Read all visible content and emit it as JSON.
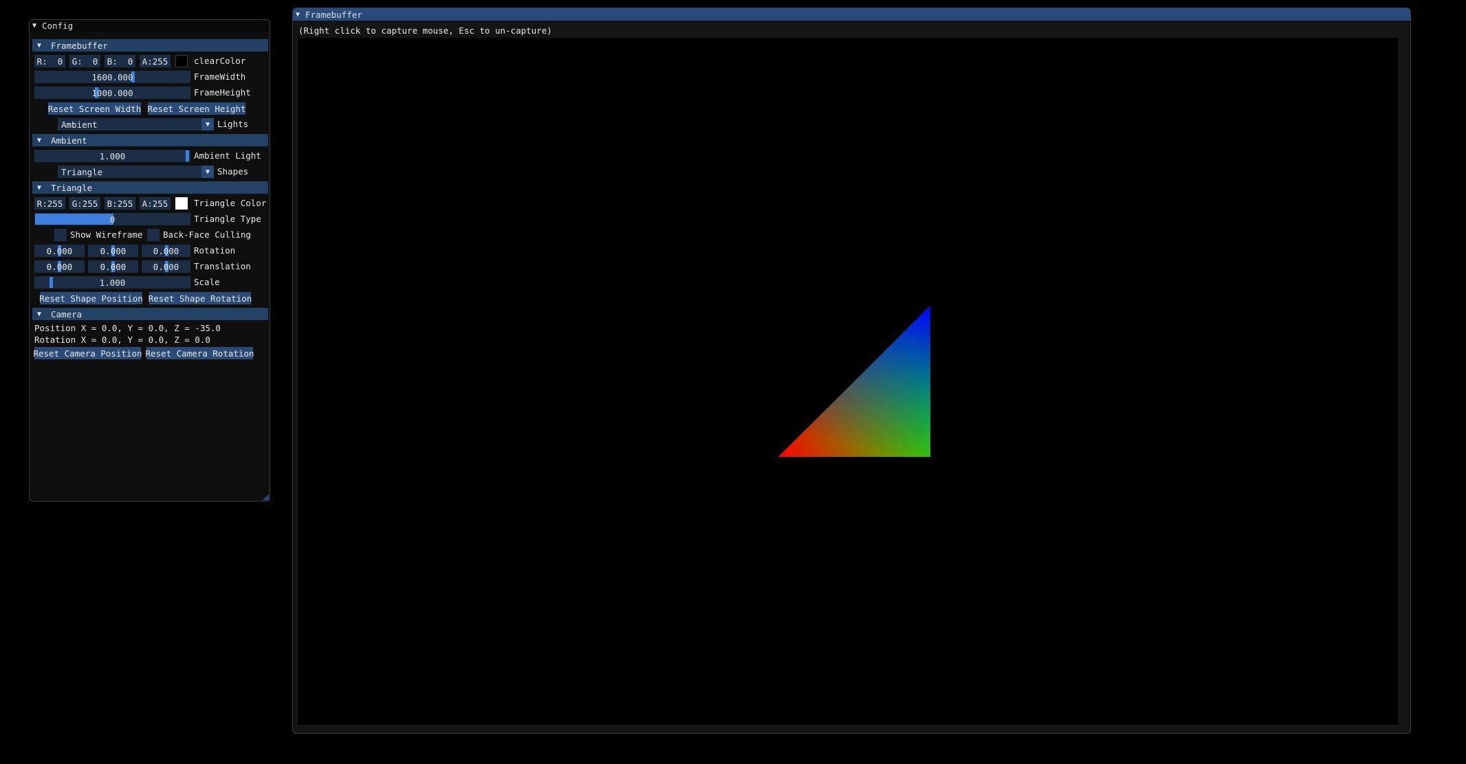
{
  "config_window": {
    "title": "Config",
    "framebuffer": {
      "header": "Framebuffer",
      "clear_color": {
        "r": "R:  0",
        "g": "G:  0",
        "b": "B:  0",
        "a": "A:255",
        "label": "clearColor",
        "swatch": "#000000"
      },
      "frame_width": {
        "value": "1600.000",
        "label": "FrameWidth",
        "fraction": 0.64
      },
      "frame_height": {
        "value": "1000.000",
        "label": "FrameHeight",
        "fraction": 0.4
      },
      "reset_width": "Reset Screen Width",
      "reset_height": "Reset Screen Height",
      "lights": {
        "selected": "Ambient",
        "label": "Lights"
      }
    },
    "ambient": {
      "header": "Ambient",
      "light": {
        "value": "1.000",
        "label": "Ambient Light",
        "fraction": 1.0
      },
      "shapes": {
        "selected": "Triangle",
        "label": "Shapes"
      }
    },
    "triangle": {
      "header": "Triangle",
      "color": {
        "r": "R:255",
        "g": "G:255",
        "b": "B:255",
        "a": "A:255",
        "label": "Triangle Color",
        "swatch": "#ffffff"
      },
      "type": {
        "value": "0",
        "label": "Triangle Type",
        "fraction": 0.5
      },
      "show_wireframe": "Show Wireframe",
      "back_face_culling": "Back-Face Culling",
      "rotation": {
        "x": "0.000",
        "y": "0.000",
        "z": "0.000",
        "label": "Rotation"
      },
      "translation": {
        "x": "0.000",
        "y": "0.000",
        "z": "0.000",
        "label": "Translation"
      },
      "scale": {
        "value": "1.000",
        "label": "Scale",
        "fraction": 0.1
      },
      "reset_position": "Reset Shape Position",
      "reset_rotation": "Reset Shape Rotation"
    },
    "camera": {
      "header": "Camera",
      "position": "Position X = 0.0, Y = 0.0, Z = -35.0",
      "rotation": "Rotation X = 0.0, Y = 0.0, Z = 0.0",
      "reset_position": "Reset Camera Position",
      "reset_rotation": "Reset Camera Rotation"
    }
  },
  "framebuffer_window": {
    "title": "Framebuffer",
    "hint": "(Right click to capture mouse, Esc to un-capture)",
    "triangle_colors": {
      "bottom_left": "#ff0000",
      "bottom_right": "#00ff00",
      "top": "#0000ff"
    }
  },
  "colors": {
    "accent": "#3d7ee0",
    "header": "#234065",
    "frame": "#1c2d46",
    "button": "#2a4a78"
  }
}
